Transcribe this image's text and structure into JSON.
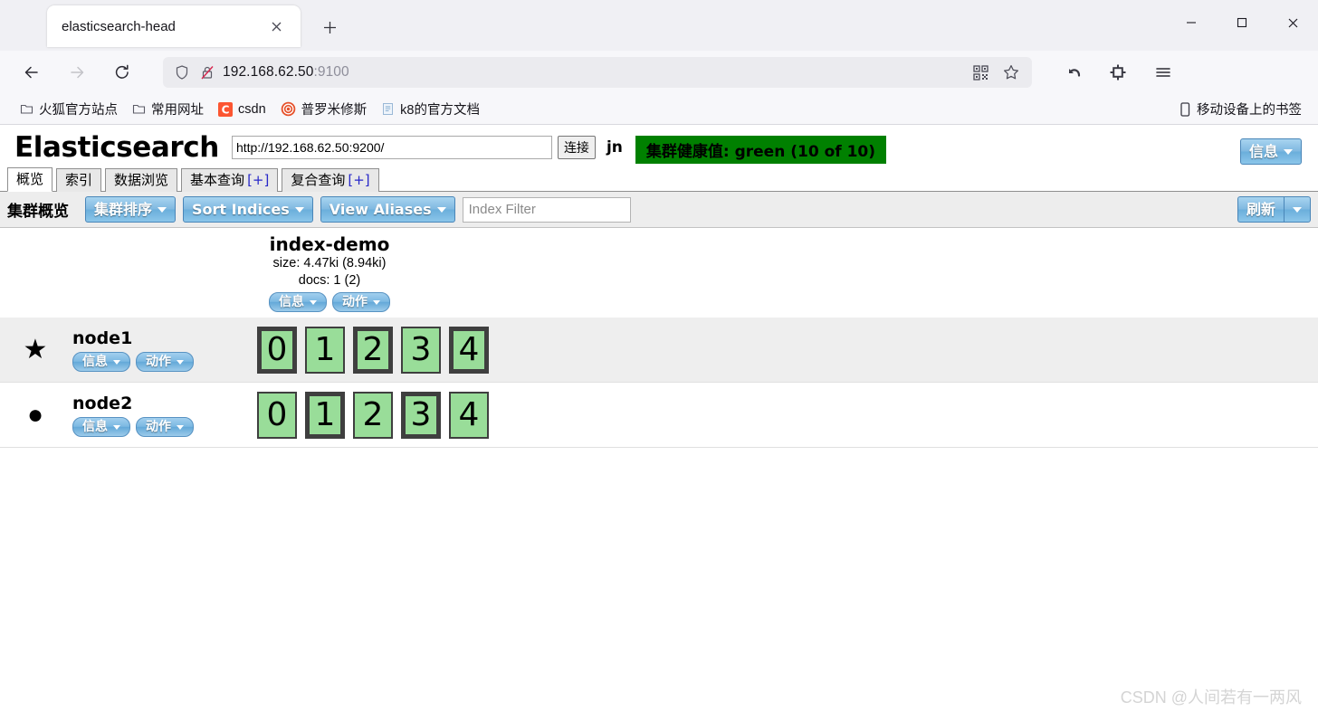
{
  "browser": {
    "tab": {
      "title": "elasticsearch-head",
      "close_label": "×",
      "new_tab_label": "+"
    },
    "window_controls": {
      "minimize": "—",
      "maximize": "□",
      "close": "✕"
    },
    "nav": {
      "back": "back-arrow",
      "forward": "forward-arrow",
      "reload": "reload-arrow"
    },
    "url": {
      "host": "192.168.62.50",
      "port": ":9100"
    },
    "bookmarks": [
      {
        "label": "火狐官方站点",
        "icon": "folder-icon"
      },
      {
        "label": "常用网址",
        "icon": "folder-icon"
      },
      {
        "label": "csdn",
        "icon": "csdn-icon"
      },
      {
        "label": "普罗米修斯",
        "icon": "prometheus-icon"
      },
      {
        "label": "k8的官方文档",
        "icon": "document-icon"
      }
    ],
    "mobile_bookmarks": {
      "label": "移动设备上的书签",
      "icon": "phone-icon"
    }
  },
  "app": {
    "title": "Elasticsearch",
    "cluster_url": "http://192.168.62.50:9200/",
    "connect_label": "连接",
    "user": "jn",
    "health": "集群健康值: green (10 of 10)",
    "health_color": "#008000",
    "info_label": "信息",
    "tabs": [
      {
        "label": "概览",
        "plus": "",
        "active": true
      },
      {
        "label": "索引",
        "plus": "",
        "active": false
      },
      {
        "label": "数据浏览",
        "plus": "",
        "active": false
      },
      {
        "label": "基本查询",
        "plus": "[+]",
        "active": false
      },
      {
        "label": "复合查询",
        "plus": "[+]",
        "active": false
      }
    ],
    "toolbar": {
      "title": "集群概览",
      "sort_cluster_label": "集群排序",
      "sort_indices_label": "Sort Indices",
      "view_aliases_label": "View Aliases",
      "index_filter_placeholder": "Index Filter",
      "index_filter_value": "",
      "refresh_label": "刷新"
    },
    "index": {
      "name": "index-demo",
      "size": "size: 4.47ki (8.94ki)",
      "docs": "docs: 1 (2)",
      "info_label": "信息",
      "action_label": "动作"
    },
    "nodes": [
      {
        "name": "node1",
        "marker": "★",
        "marker_name": "master-node-star-icon",
        "info_label": "信息",
        "action_label": "动作",
        "shards": [
          {
            "label": "0",
            "type": "primary"
          },
          {
            "label": "1",
            "type": "replica"
          },
          {
            "label": "2",
            "type": "primary"
          },
          {
            "label": "3",
            "type": "replica"
          },
          {
            "label": "4",
            "type": "primary"
          }
        ]
      },
      {
        "name": "node2",
        "marker": "●",
        "marker_name": "data-node-circle-icon",
        "info_label": "信息",
        "action_label": "动作",
        "shards": [
          {
            "label": "0",
            "type": "replica"
          },
          {
            "label": "1",
            "type": "primary"
          },
          {
            "label": "2",
            "type": "replica"
          },
          {
            "label": "3",
            "type": "primary"
          },
          {
            "label": "4",
            "type": "replica"
          }
        ]
      }
    ],
    "shard_color": "#99dd99",
    "watermark": "CSDN @人间若有一两风"
  }
}
